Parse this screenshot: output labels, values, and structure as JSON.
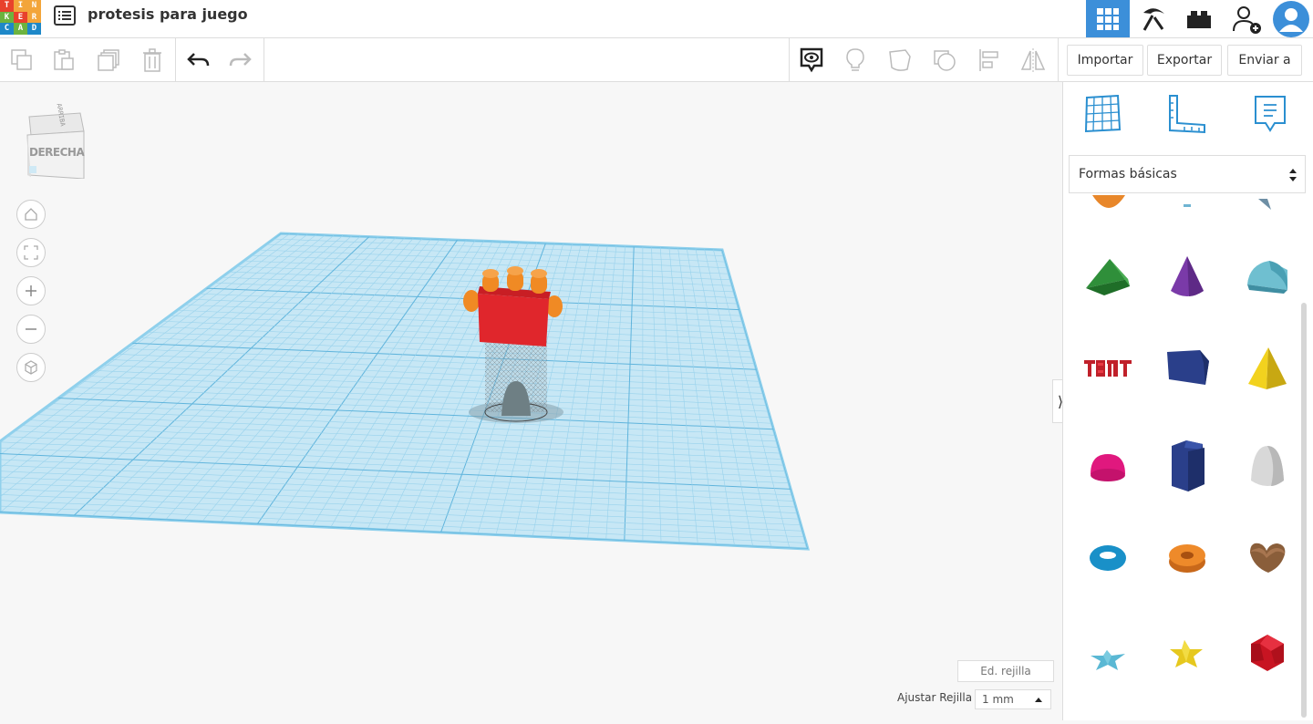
{
  "app": {
    "logo_letters": [
      "T",
      "I",
      "N",
      "K",
      "E",
      "R",
      "C",
      "A",
      "D"
    ],
    "logo_colors": [
      "#e8412c",
      "#f3a53a",
      "#f3a53a",
      "#6cb33f",
      "#e8412c",
      "#f3a53a",
      "#1e88c8",
      "#6cb33f",
      "#1e88c8"
    ],
    "project_title": "protesis para juego"
  },
  "toolbar": {
    "import_label": "Importar",
    "export_label": "Exportar",
    "send_label": "Enviar a"
  },
  "viewcube": {
    "face_label": "DERECHA",
    "top_label": "ARRIBA"
  },
  "panel": {
    "shape_category": "Formas básicas"
  },
  "grid": {
    "edit_label": "Ed. rejilla",
    "snap_label": "Ajustar Rejilla",
    "snap_value": "1 mm"
  },
  "colors": {
    "accent": "#1477d0",
    "workplane": "#bfe3f3",
    "grid_line": "#7fc6e6"
  }
}
